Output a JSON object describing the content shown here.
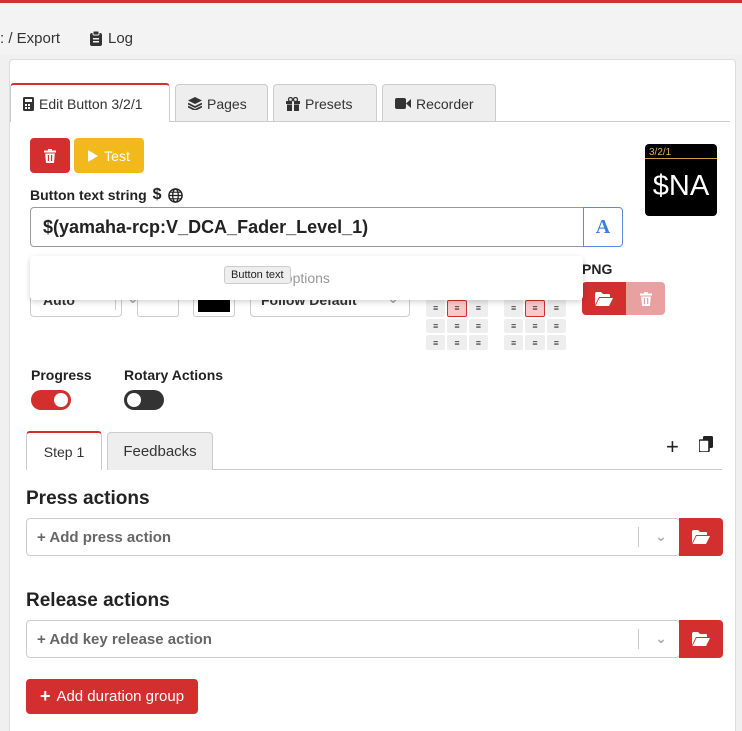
{
  "topnav": {
    "items": [
      {
        "label": ": / Export"
      },
      {
        "label": "Log"
      }
    ]
  },
  "tabs": [
    {
      "label": "Edit Button 3/2/1",
      "icon": "calculator-icon"
    },
    {
      "label": "Pages",
      "icon": "layers-icon"
    },
    {
      "label": "Presets",
      "icon": "gift-icon"
    },
    {
      "label": "Recorder",
      "icon": "video-icon"
    }
  ],
  "toolbar": {
    "test_label": "Test"
  },
  "button_text": {
    "label": "Button text string",
    "value": "$(yamaha-rcp:V_DCA_Fader_Level_1)",
    "font_button": "A"
  },
  "dropdown": {
    "no_options": "No options",
    "tooltip": "Button text"
  },
  "style_row": {
    "size_value": "Auto",
    "alignment_value": "Follow Default",
    "png_label": "PNG"
  },
  "preview": {
    "top_text": "3/2/1",
    "text": "$NA"
  },
  "toggles": [
    {
      "label": "Progress",
      "on": true
    },
    {
      "label": "Rotary Actions",
      "on": false
    }
  ],
  "step_tabs": [
    {
      "label": "Step 1"
    },
    {
      "label": "Feedbacks"
    }
  ],
  "press": {
    "heading": "Press actions",
    "placeholder": "+ Add press action"
  },
  "release": {
    "heading": "Release actions",
    "placeholder": "+ Add key release action"
  },
  "duration": {
    "label": "Add duration group"
  },
  "colors": {
    "accent": "#d32f2f",
    "warning": "#f2b91c",
    "link": "#3b7de0"
  }
}
